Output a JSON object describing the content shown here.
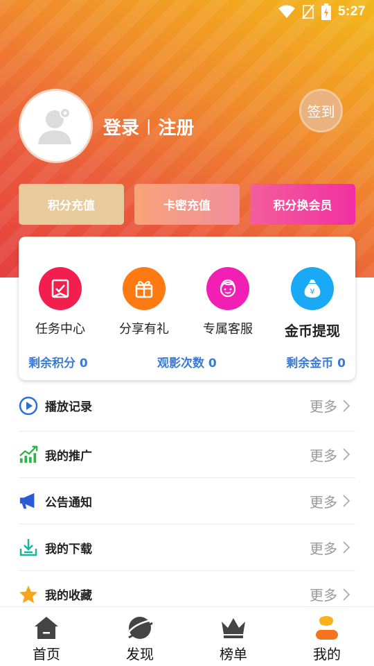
{
  "status_bar": {
    "time": "5:27"
  },
  "header": {
    "login": "登录",
    "separator": "|",
    "register": "注册",
    "signin": "签到"
  },
  "actions": [
    {
      "label": "积分充值"
    },
    {
      "label": "卡密充值"
    },
    {
      "label": "积分换会员"
    }
  ],
  "features": [
    {
      "label": "任务中心",
      "icon": "task-icon",
      "color": "#f21f4e"
    },
    {
      "label": "分享有礼",
      "icon": "gift-icon",
      "color": "#ff7a12"
    },
    {
      "label": "专属客服",
      "icon": "service-icon",
      "color": "#f21fb4"
    },
    {
      "label": "金币提现",
      "icon": "money-bag-icon",
      "color": "#1aa9f5"
    }
  ],
  "stats": {
    "points": "剩余积分 0",
    "views": "观影次数 0",
    "coins": "剩余金币 0"
  },
  "menu": [
    {
      "label": "播放记录",
      "more": "更多",
      "icon": "play-icon"
    },
    {
      "label": "我的推广",
      "more": "更多",
      "icon": "chart-icon"
    },
    {
      "label": "公告通知",
      "more": "更多",
      "icon": "megaphone-icon"
    },
    {
      "label": "我的下载",
      "more": "更多",
      "icon": "download-icon"
    },
    {
      "label": "我的收藏",
      "more": "更多",
      "icon": "star-icon"
    }
  ],
  "tabs": [
    {
      "label": "首页",
      "icon": "home-icon"
    },
    {
      "label": "发现",
      "icon": "planet-icon"
    },
    {
      "label": "榜单",
      "icon": "crown-icon"
    },
    {
      "label": "我的",
      "icon": "user-icon",
      "active": true
    }
  ],
  "colors": {
    "accent_blue": "#3a7bd5",
    "hero_top": "#f2b81a",
    "hero_bottom": "#e4403f"
  }
}
